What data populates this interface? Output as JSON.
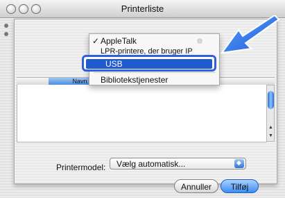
{
  "window": {
    "title": "Printerliste"
  },
  "table": {
    "column_header": "Navn"
  },
  "menu": {
    "items": [
      {
        "label": "AppleTalk",
        "checked": true
      },
      {
        "label": "LPR-printere, der bruger IP"
      },
      {
        "label": "USB",
        "highlighted": true
      },
      {
        "label": "Bibliotekstjenester"
      }
    ]
  },
  "form": {
    "printer_model_label": "Printermodel:",
    "printer_model_value": "Vælg automatisk..."
  },
  "buttons": {
    "cancel": "Annuller",
    "add": "Tilføj"
  },
  "colors": {
    "accent": "#2f5fe0",
    "highlight": "#1f5ad1",
    "arrow": "#1e5bd6"
  },
  "icons": {
    "check": "checkmark-icon",
    "arrow": "pointer-arrow-icon"
  }
}
